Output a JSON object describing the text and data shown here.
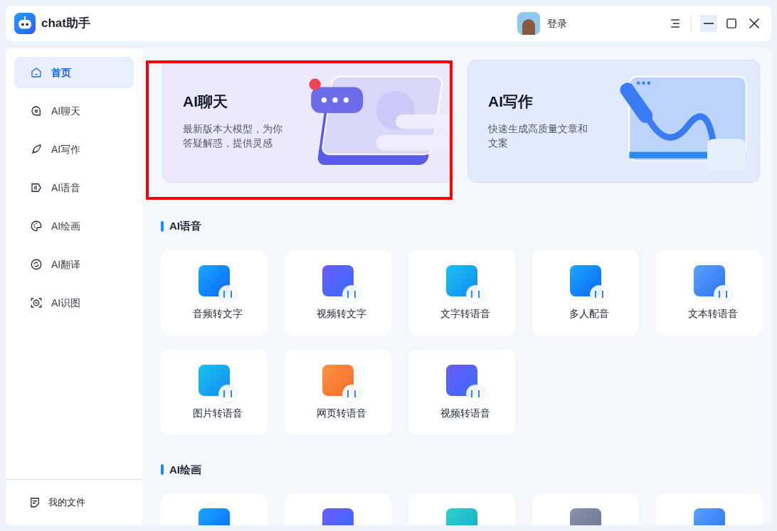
{
  "window": {
    "title": "chat助手",
    "login": "登录"
  },
  "sidebar": {
    "items": [
      {
        "label": "首页",
        "selected": true
      },
      {
        "label": "AI聊天",
        "selected": false
      },
      {
        "label": "AI写作",
        "selected": false
      },
      {
        "label": "AI语音",
        "selected": false
      },
      {
        "label": "AI绘画",
        "selected": false
      },
      {
        "label": "AI翻译",
        "selected": false
      },
      {
        "label": "AI识图",
        "selected": false
      }
    ],
    "footer": "我的文件"
  },
  "feature_cards": [
    {
      "title": "AI聊天",
      "description": "最新版本大模型，为你答疑解惑，提供灵感",
      "highlighted": true
    },
    {
      "title": "AI写作",
      "description": "快速生成高质量文章和文案",
      "highlighted": false
    }
  ],
  "sections": [
    {
      "title": "AI语音",
      "tiles": [
        {
          "kind": "blue",
          "label": "音频转文字"
        },
        {
          "kind": "violet",
          "label": "视频转文字"
        },
        {
          "kind": "cyan",
          "label": "文字转语音"
        },
        {
          "kind": "blue",
          "label": "多人配音"
        },
        {
          "kind": "sky",
          "label": "文本转语音"
        },
        {
          "kind": "cyan",
          "label": "图片转语音"
        },
        {
          "kind": "orange",
          "label": "网页转语音"
        },
        {
          "kind": "violet",
          "label": "视频转语音"
        }
      ]
    },
    {
      "title": "AI绘画",
      "tiles": [
        {
          "kind": "blue"
        },
        {
          "kind": "violet"
        },
        {
          "kind": "teal"
        },
        {
          "kind": "gray"
        },
        {
          "kind": "sky"
        }
      ]
    }
  ]
}
